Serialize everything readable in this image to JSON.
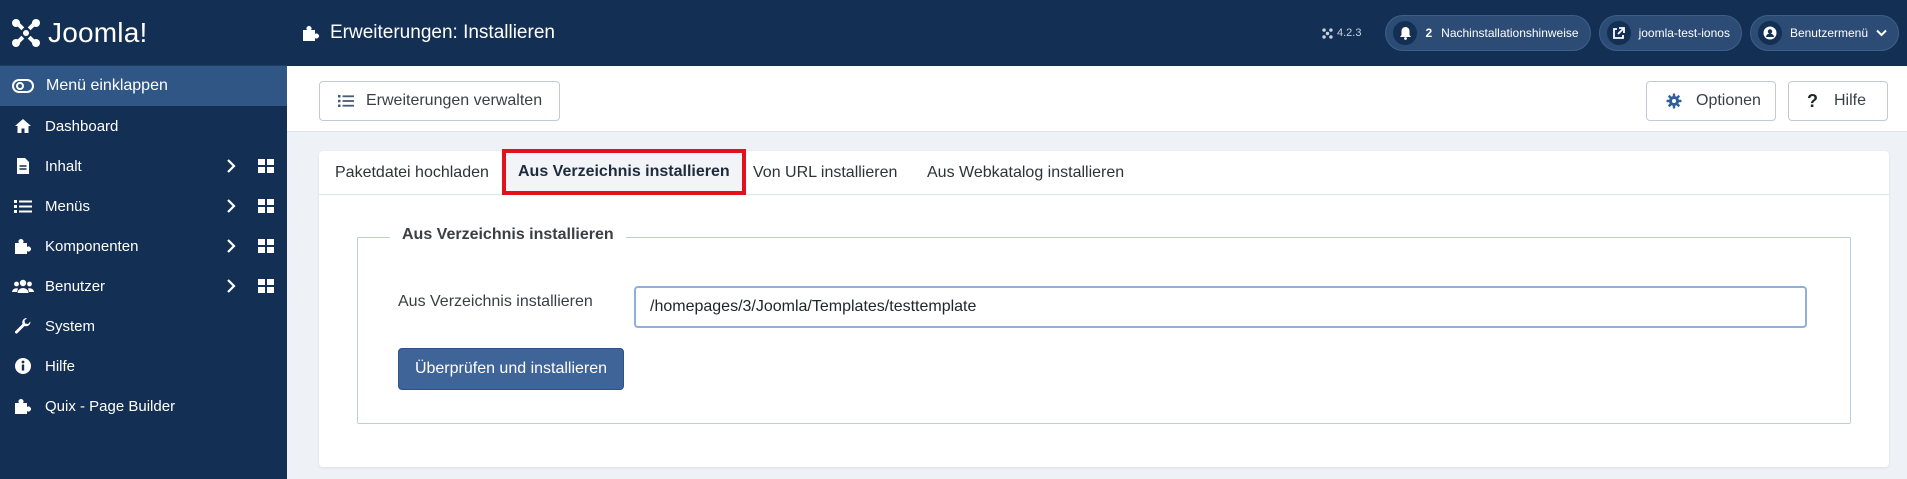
{
  "app": {
    "logo_text": "Joomla!"
  },
  "sidebar": {
    "collapse_label": "Menü einklappen",
    "items": [
      {
        "label": "Dashboard",
        "icon": "home-icon"
      },
      {
        "label": "Inhalt",
        "icon": "file-icon",
        "has_submenu": true
      },
      {
        "label": "Menüs",
        "icon": "list-icon",
        "has_submenu": true
      },
      {
        "label": "Komponenten",
        "icon": "puzzle-icon",
        "has_submenu": true
      },
      {
        "label": "Benutzer",
        "icon": "users-icon",
        "has_submenu": true
      },
      {
        "label": "System",
        "icon": "wrench-icon"
      },
      {
        "label": "Hilfe",
        "icon": "info-icon"
      },
      {
        "label": "Quix - Page Builder",
        "icon": "puzzle-icon"
      }
    ]
  },
  "header": {
    "title": "Erweiterungen: Installieren",
    "version": "4.2.3",
    "notifications": {
      "count": "2",
      "label": "Nachinstallationshinweise"
    },
    "site_link": "joomla-test-ionos",
    "user_menu": "Benutzermenü"
  },
  "toolbar": {
    "manage_label": "Erweiterungen verwalten",
    "options_label": "Optionen",
    "help_label": "Hilfe"
  },
  "tabs": [
    {
      "label": "Paketdatei hochladen",
      "active": false
    },
    {
      "label": "Aus Verzeichnis installieren",
      "active": true
    },
    {
      "label": "Von URL installieren",
      "active": false
    },
    {
      "label": "Aus Webkatalog installieren",
      "active": false
    }
  ],
  "form": {
    "legend": "Aus Verzeichnis installieren",
    "field_label": "Aus Verzeichnis installieren",
    "directory_value": "/homepages/3/Joomla/Templates/testtemplate",
    "submit_label": "Überprüfen und installieren"
  },
  "colors": {
    "sidebar_bg": "#132f53",
    "collapse_bg": "#2f5684",
    "primary_button": "#3f6598",
    "active_tab_highlight": "#e2121c"
  }
}
